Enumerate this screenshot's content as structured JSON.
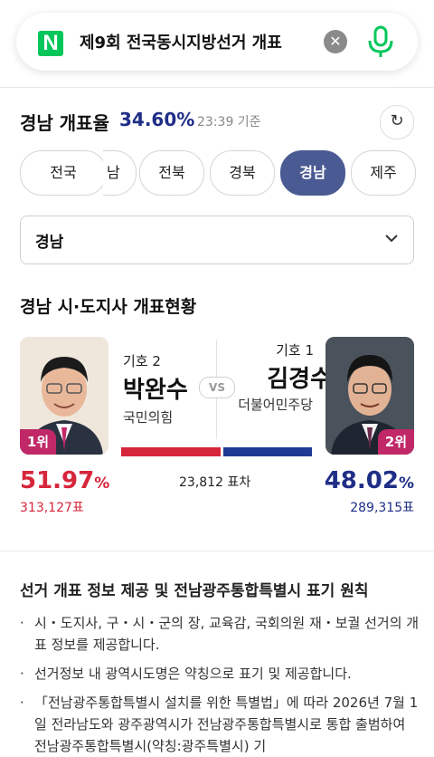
{
  "search": {
    "logo": "N",
    "query": "제9회 전국동시지방선거 개표",
    "clear_icon": "close-icon",
    "mic_icon": "mic-icon",
    "mic_color": "#03c75a"
  },
  "rate": {
    "title": "경남 개표율",
    "value": "34.60%",
    "time": "23:39 기준",
    "refresh_icon": "refresh-icon"
  },
  "region_chips": [
    "전국",
    "남",
    "전북",
    "경북",
    "경남",
    "제주"
  ],
  "selected_chip": "경남",
  "select": {
    "value": "경남",
    "chevron": "chevron-down-icon"
  },
  "section_title": "경남 시·도지사 개표현황",
  "candidates": {
    "left": {
      "symbol": "기호 2",
      "name": "박완수",
      "party": "국민의힘",
      "rank": "1위",
      "percent": "51.97",
      "votes": "313,127표",
      "color": "#d6263b"
    },
    "right": {
      "symbol": "기호 1",
      "name": "김경수",
      "party": "더불어민주당",
      "rank": "2위",
      "percent": "48.02",
      "votes": "289,315표",
      "color": "#1f2e86"
    },
    "vs": "VS",
    "margin": "23,812 표차",
    "percent_unit": "%"
  },
  "notice": {
    "title": "선거 개표 정보 제공 및 전남광주통합특별시 표기 원칙",
    "items": [
      "시・도지사, 구・시・군의 장, 교육감, 국회의원 재・보궐 선거의 개표 정보를 제공합니다.",
      "선거정보 내 광역시도명은 약칭으로 표기 및 제공합니다.",
      "「전남광주통합특별시 설치를 위한 특별법」에 따라 2026년 7월 1일 전라남도와 광주광역시가 전남광주통합특별시로 통합 출범하여 전남광주통합특별시(약칭:광주특별시) 기"
    ]
  }
}
